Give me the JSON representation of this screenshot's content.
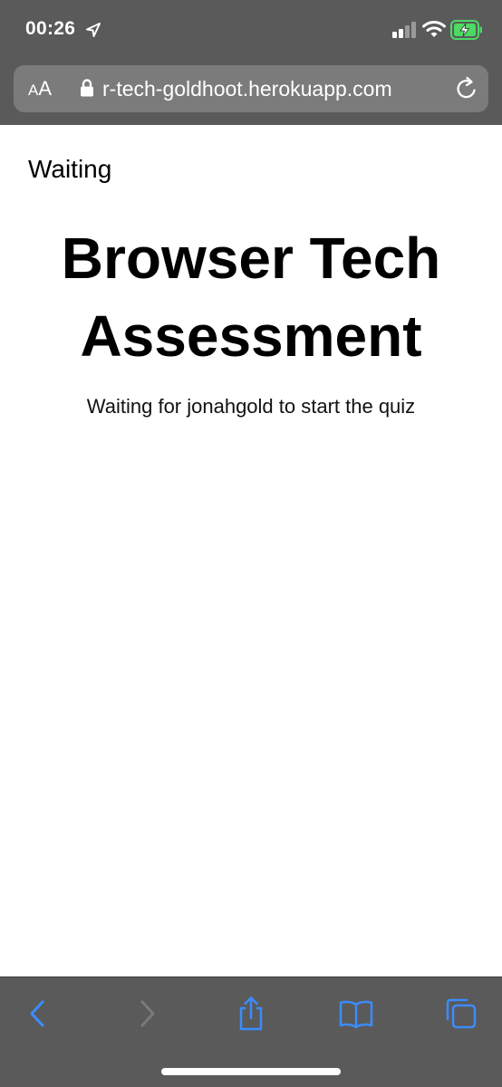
{
  "status_bar": {
    "time": "00:26",
    "location_icon": "location-arrow-icon",
    "signal_icon": "cellular-signal-icon",
    "wifi_icon": "wifi-icon",
    "battery_icon": "battery-charging-icon",
    "battery_color": "#4cd964"
  },
  "browser": {
    "text_size_label_small": "A",
    "text_size_label_large": "A",
    "url": "r-tech-goldhoot.herokuapp.com",
    "lock_icon": "lock-icon",
    "reload_icon": "reload-icon",
    "chrome_color": "#5a5a5a",
    "url_bar_color": "#7b7b7b",
    "accent_color": "#3b8cff"
  },
  "page": {
    "label": "Waiting",
    "title": "Browser Tech Assessment",
    "status": "Waiting for jonahgold to start the quiz"
  },
  "toolbar": {
    "back_icon": "chevron-left-icon",
    "forward_icon": "chevron-right-icon",
    "share_icon": "share-icon",
    "bookmarks_icon": "book-icon",
    "tabs_icon": "tabs-icon"
  }
}
